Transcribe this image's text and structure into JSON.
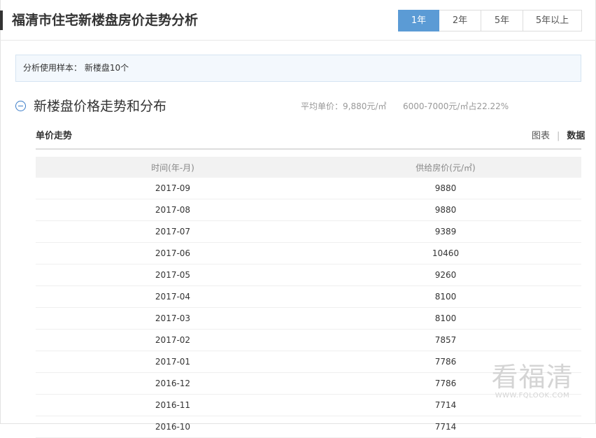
{
  "header": {
    "title": "福清市住宅新楼盘房价走势分析",
    "range_tabs": [
      {
        "label": "1年",
        "active": true
      },
      {
        "label": "2年",
        "active": false
      },
      {
        "label": "5年",
        "active": false
      },
      {
        "label": "5年以上",
        "active": false
      }
    ]
  },
  "sample": {
    "text": "分析使用样本：  新楼盘10个"
  },
  "section": {
    "title": "新楼盘价格走势和分布",
    "avg_price": "平均单价：9,880元/㎡",
    "price_range_share": "6000-7000元/㎡占22.22%"
  },
  "panel": {
    "subtitle": "单价走势",
    "view_chart_label": "图表",
    "view_data_label": "数据",
    "active_view": "数据"
  },
  "table": {
    "headers": [
      "时间(年-月)",
      "供给房价(元/㎡)"
    ],
    "rows": [
      [
        "2017-09",
        "9880"
      ],
      [
        "2017-08",
        "9880"
      ],
      [
        "2017-07",
        "9389"
      ],
      [
        "2017-06",
        "10460"
      ],
      [
        "2017-05",
        "9260"
      ],
      [
        "2017-04",
        "8100"
      ],
      [
        "2017-03",
        "8100"
      ],
      [
        "2017-02",
        "7857"
      ],
      [
        "2017-01",
        "7786"
      ],
      [
        "2016-12",
        "7786"
      ],
      [
        "2016-11",
        "7714"
      ],
      [
        "2016-10",
        "7714"
      ]
    ]
  },
  "watermark": {
    "main": "看福清",
    "url": "WWW.FQLOOK.COM"
  },
  "colors": {
    "accent": "#5b9bd5",
    "icon": "#3a7cc8",
    "sample_bg": "#f3f8fd"
  }
}
